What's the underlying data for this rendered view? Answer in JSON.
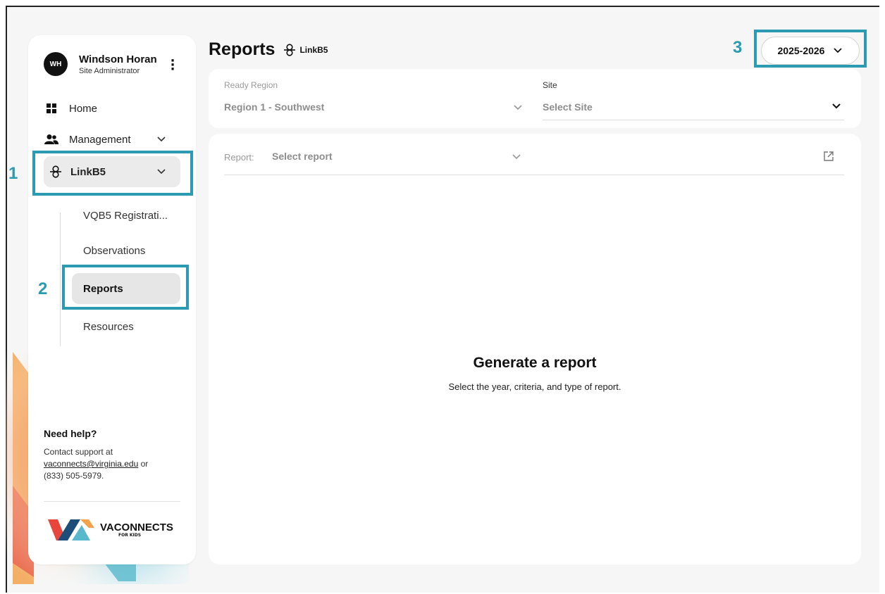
{
  "user": {
    "initials": "WH",
    "name": "Windson Horan",
    "role": "Site Administrator"
  },
  "nav": {
    "home": "Home",
    "management": "Management",
    "linkb5": "LinkB5",
    "sub_items": [
      "VQB5 Registrati...",
      "Observations",
      "Reports",
      "Resources"
    ]
  },
  "help": {
    "title": "Need help?",
    "line1": "Contact support at",
    "email": "vaconnects@virginia.edu",
    "or": " or",
    "phone": "(833) 505-5979."
  },
  "logo": {
    "word": "VACONNECTS",
    "sub": "FOR KIDS"
  },
  "header": {
    "title": "Reports",
    "badge": "LinkB5",
    "year": "2025-2026"
  },
  "filters": {
    "region_label": "Ready Region",
    "region_value": "Region 1 - Southwest",
    "site_label": "Site",
    "site_value": "Select Site"
  },
  "report": {
    "label": "Report:",
    "select_value": "Select report",
    "empty_title": "Generate a report",
    "empty_subtitle": "Select the year, criteria, and type of report."
  },
  "callouts": [
    "1",
    "2",
    "3"
  ],
  "colors": {
    "callout": "#2a9bb0",
    "active_bg": "#ebebeb"
  },
  "icons": [
    "grid-icon",
    "users-icon",
    "linkb5-icon",
    "chevron-down-icon",
    "external-link-icon",
    "kebab-icon"
  ]
}
